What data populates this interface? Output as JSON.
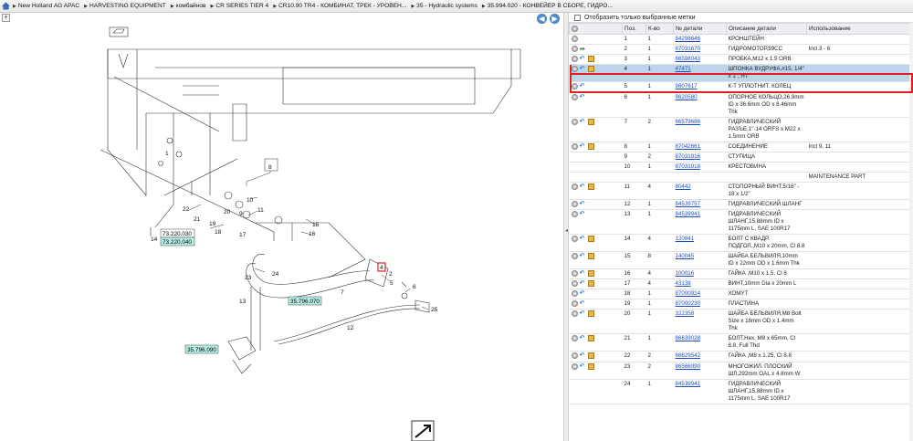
{
  "breadcrumbs": [
    "New Holland AG APAC",
    "HARVESTING EQUIPMENT",
    "комбайнов",
    "CR SERIES TIER 4",
    "CR10.90 TR4 - КОМБИНАТ, ТРЕК - УРОВЕН...",
    "35 - Hydraulic systems",
    "35.994.020 - КОНВЕЙЕР В СБОРЕ, ГИДРО..."
  ],
  "diagram": {
    "nav_prev": "◀",
    "nav_next": "▶",
    "zoom_symbol": "+",
    "refs": {
      "r1": "73.220.030",
      "r2": "73.220.040",
      "r3": "35.796.070",
      "r4": "35.796.090"
    },
    "callouts": {
      "c1": "1",
      "c2": "2",
      "c4": "4",
      "c5": "5",
      "c6": "6",
      "c7": "7",
      "c8": "8",
      "c9": "9",
      "c10": "10",
      "c11": "11",
      "c12": "12",
      "c13": "13",
      "c14": "14",
      "c15": "15",
      "c16": "16",
      "c17": "17",
      "c18": "18",
      "c19": "19",
      "c22": "22",
      "c23": "23",
      "c24": "24",
      "c25": "25",
      "c3": "3"
    }
  },
  "parts_panel": {
    "filter_label": "Отобразить только выбранные метки",
    "columns": [
      "Поз.",
      "К-во",
      "№ детали",
      "Описание детали",
      "Использование"
    ],
    "rows": [
      {
        "icons": [
          "circle"
        ],
        "pos": "1",
        "qty": "1",
        "part": "84298646",
        "desc": "КРОНШТЕЙН",
        "usage": ""
      },
      {
        "icons": [
          "circle",
          "green"
        ],
        "pos": "2",
        "qty": "1",
        "part": "87031670",
        "desc": "ГИДРОМОТОР,59CC",
        "usage": "Incl 3 - 6"
      },
      {
        "icons": [
          "circle",
          "arrow",
          "box"
        ],
        "pos": "3",
        "qty": "1",
        "part": "86598043",
        "desc": "ПРОБКА,M12 x 1.5 ORB",
        "usage": ""
      },
      {
        "icons": [
          "circle",
          "arrow",
          "box"
        ],
        "pos": "4",
        "qty": "1",
        "part": "47471",
        "desc": "ШПОНКА ВУДРУФА,#15, 1/4\" x 1\", HT",
        "usage": "",
        "selected": true
      },
      {
        "icons": [
          "circle",
          "arrow"
        ],
        "pos": "5",
        "qty": "1",
        "part": "9807617",
        "desc": "К-Т УПЛОТНИТ. КОЛЕЦ",
        "usage": ""
      },
      {
        "icons": [
          "circle",
          "arrow"
        ],
        "pos": "6",
        "qty": "1",
        "part": "9620580",
        "desc": "ОПОРНОЕ КОЛЬЦО,26.9mm ID x 36.6mm OD x 8.46mm Thk",
        "usage": ""
      },
      {
        "icons": [
          "circle",
          "arrow",
          "box"
        ],
        "pos": "7",
        "qty": "2",
        "part": "86579686",
        "desc": "ГИДРАВЛИЧЕСКИЙ РАЗЪЕ,1\"-14 ORFS x M22 x 1.5mm ORB",
        "usage": ""
      },
      {
        "icons": [
          "circle",
          "arrow",
          "box"
        ],
        "pos": "8",
        "qty": "1",
        "part": "87042661",
        "desc": "СОЕДИНЕНИЕ",
        "usage": "Incl 9, 11"
      },
      {
        "icons": [],
        "pos": "9",
        "qty": "2",
        "part": "87031916",
        "desc": "СТУПИЦА",
        "usage": ""
      },
      {
        "icons": [],
        "pos": "10",
        "qty": "1",
        "part": "87031918",
        "desc": "КРЕСТОВИНА",
        "usage": ""
      },
      {
        "icons": [],
        "pos": "",
        "qty": "",
        "part": "",
        "desc": "",
        "usage": "MAINTENANCE PART"
      },
      {
        "icons": [
          "circle",
          "arrow",
          "box"
        ],
        "pos": "11",
        "qty": "4",
        "part": "80442",
        "desc": "СТОПОРНЫЙ ВИНТ,5/16\" - 18 x 1/2\"",
        "usage": ""
      },
      {
        "icons": [
          "circle",
          "arrow"
        ],
        "pos": "12",
        "qty": "1",
        "part": "84539757",
        "desc": "ГИДРАВЛИЧЕСКИЙ ШЛАНГ",
        "usage": ""
      },
      {
        "icons": [
          "circle",
          "arrow"
        ],
        "pos": "13",
        "qty": "1",
        "part": "84539941",
        "desc": "ГИДРАВЛИЧЕСКИЙ ШЛАНГ,15.88mm ID x 1175mm L, SAE 100R17",
        "usage": ""
      },
      {
        "icons": [
          "circle",
          "arrow",
          "box"
        ],
        "pos": "14",
        "qty": "4",
        "part": "120841",
        "desc": "БОЛТ С КВАДР. ПОДГОЛ.,M10 x 20mm, Cl 8.8",
        "usage": ""
      },
      {
        "icons": [
          "circle",
          "arrow",
          "box"
        ],
        "pos": "15",
        "qty": "8",
        "part": "140045",
        "desc": "ШАЙБА БЕЛЬВИЛЯ,10mm ID x 22mm OD x 1.6mm Thk",
        "usage": ""
      },
      {
        "icons": [
          "circle",
          "arrow",
          "box"
        ],
        "pos": "16",
        "qty": "4",
        "part": "100016",
        "desc": "ГАЙКА ,M10 x 1.5, Cl 8",
        "usage": ""
      },
      {
        "icons": [
          "circle",
          "arrow",
          "box"
        ],
        "pos": "17",
        "qty": "4",
        "part": "43138",
        "desc": "ВИНТ,10mm Dia x 20mm L",
        "usage": ""
      },
      {
        "icons": [
          "circle",
          "arrow"
        ],
        "pos": "18",
        "qty": "1",
        "part": "87000924",
        "desc": "ХОМУТ",
        "usage": ""
      },
      {
        "icons": [
          "circle",
          "arrow"
        ],
        "pos": "19",
        "qty": "1",
        "part": "87000230",
        "desc": "ПЛАСТИНА",
        "usage": ""
      },
      {
        "icons": [
          "circle",
          "arrow",
          "box"
        ],
        "pos": "20",
        "qty": "1",
        "part": "322358",
        "desc": "ШАЙБА БЕЛЬВИЛЯ,M8 Bolt Size x 18mm OD x 1.4mm Thk",
        "usage": ""
      },
      {
        "icons": [
          "circle",
          "arrow",
          "box"
        ],
        "pos": "21",
        "qty": "1",
        "part": "86639028",
        "desc": "БОЛТ,Hex, M8 x 65mm, Cl 8.8, Full Thd",
        "usage": ""
      },
      {
        "icons": [
          "circle",
          "arrow",
          "box"
        ],
        "pos": "22",
        "qty": "2",
        "part": "86629542",
        "desc": "ГАЙКА ,M8 x 1.25, Cl 8.8",
        "usage": ""
      },
      {
        "icons": [
          "circle",
          "arrow",
          "box"
        ],
        "pos": "23",
        "qty": "2",
        "part": "86566990",
        "desc": "МНОГОЖИЛ. ПЛОСКИЙ ШЛ,292mm OAL x 4.8mm W",
        "usage": ""
      },
      {
        "icons": [],
        "pos": "24",
        "qty": "1",
        "part": "84539941",
        "desc": "ГИДРАВЛИЧЕСКИЙ ШЛАНГ,15.88mm ID x 1175mm L, SAE 100R17",
        "usage": ""
      }
    ]
  }
}
